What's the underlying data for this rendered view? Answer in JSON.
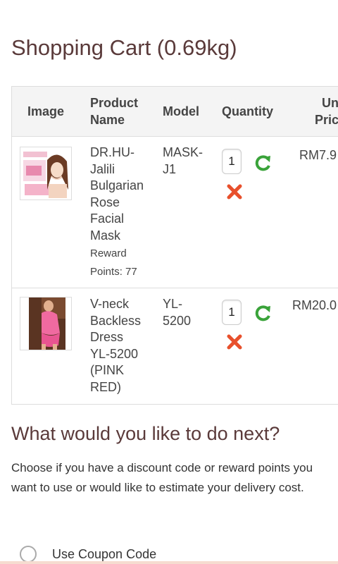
{
  "page": {
    "title": "Shopping Cart  (0.69kg)"
  },
  "table": {
    "headers": {
      "image": "Image",
      "product_name_1": "Product",
      "product_name_2": "Name",
      "model": "Model",
      "quantity": "Quantity",
      "unit_price_1": "Un",
      "unit_price_2": "Pric"
    },
    "rows": [
      {
        "name_lines": [
          "DR.HU-",
          "Jalili",
          "Bulgarian",
          "Rose",
          "Facial",
          "Mask"
        ],
        "reward_lines": [
          "Reward",
          "Points: 77"
        ],
        "model_lines": [
          "MASK-",
          "J1"
        ],
        "quantity": "1",
        "price": "RM7.9"
      },
      {
        "name_lines": [
          "V-neck",
          "Backless",
          "Dress",
          "YL-5200",
          "(PINK",
          "RED)"
        ],
        "model_lines": [
          "YL-",
          "5200"
        ],
        "quantity": "1",
        "price": "RM20.0"
      }
    ]
  },
  "next": {
    "title": "What would you like to do next?",
    "description": "Choose if you have a discount code or reward points you want to use or would like to estimate your delivery cost."
  },
  "options": {
    "coupon_label": "Use Coupon Code"
  },
  "colors": {
    "accent_green": "#3aa33a",
    "remove_red": "#e8502c",
    "heading": "#5a3a3a"
  }
}
